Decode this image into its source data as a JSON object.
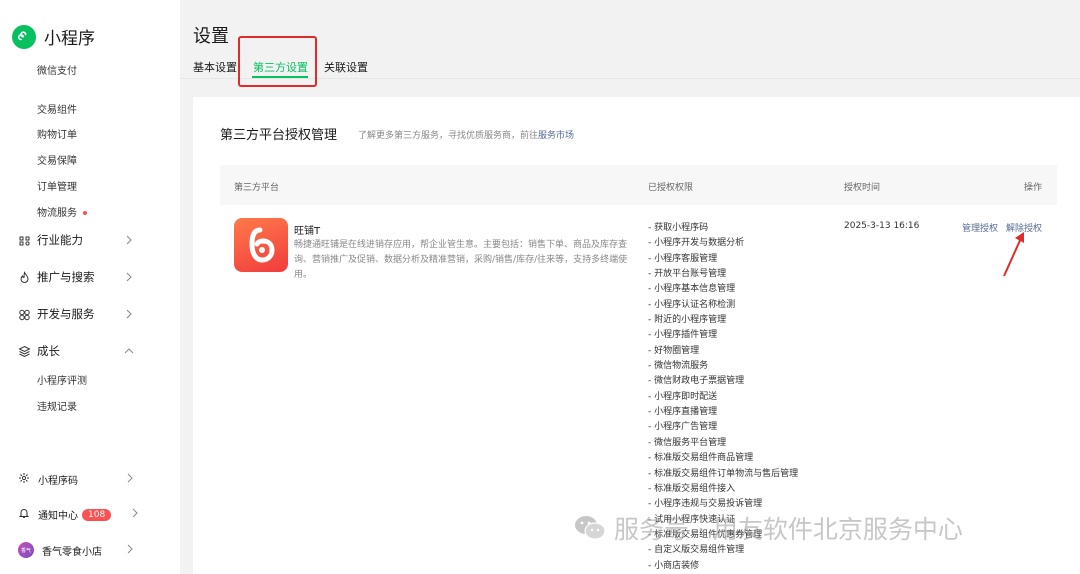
{
  "app": {
    "name": "小程序"
  },
  "sidebar": {
    "top_item": "微信支付",
    "sub_items": [
      {
        "label": "交易组件"
      },
      {
        "label": "购物订单"
      },
      {
        "label": "交易保障"
      },
      {
        "label": "订单管理"
      },
      {
        "label": "物流服务",
        "has_dot": true
      }
    ],
    "groups": [
      {
        "label": "行业能力",
        "icon": "industry-icon",
        "expanded": false
      },
      {
        "label": "推广与搜索",
        "icon": "promote-icon",
        "expanded": false
      },
      {
        "label": "开发与服务",
        "icon": "develop-icon",
        "expanded": false
      },
      {
        "label": "成长",
        "icon": "growth-icon",
        "expanded": true
      }
    ],
    "growth_items": [
      {
        "label": "小程序评测"
      },
      {
        "label": "违规记录"
      }
    ],
    "bottom": {
      "qrcode_label": "小程序码",
      "notify_label": "通知中心",
      "notify_count": "108",
      "account_label": "香气零食小店",
      "avatar_text": "香气"
    }
  },
  "page": {
    "title": "设置",
    "tabs": [
      {
        "label": "基本设置",
        "active": false
      },
      {
        "label": "第三方设置",
        "active": true
      },
      {
        "label": "关联设置",
        "active": false
      }
    ]
  },
  "section": {
    "title": "第三方平台授权管理",
    "note": "了解更多第三方服务，寻找优质服务商，前往",
    "note_link": "服务市场",
    "columns": [
      "第三方平台",
      "已授权权限",
      "授权时间",
      "操作"
    ]
  },
  "row": {
    "app_name": "旺铺T",
    "app_desc": "畅捷通旺铺是在线进销存应用，帮企业管生意。主要包括：销售下单、商品及库存查询、营销推广及促销、数据分析及精准营销，采购/销售/库存/往来等，支持多终端使用。",
    "permissions": [
      "- 获取小程序码",
      "- 小程序开发与数据分析",
      "- 小程序客服管理",
      "- 开放平台账号管理",
      "- 小程序基本信息管理",
      "- 小程序认证名称检测",
      "- 附近的小程序管理",
      "- 小程序插件管理",
      "- 好物圈管理",
      "- 微信物流服务",
      "- 微信财政电子票据管理",
      "- 小程序即时配送",
      "- 小程序直播管理",
      "- 小程序广告管理",
      "- 微信服务平台管理",
      "- 标准版交易组件商品管理",
      "- 标准版交易组件订单物流与售后管理",
      "- 标准版交易组件接入",
      "- 小程序违规与交易投诉管理",
      "- 试用小程序快速认证",
      "- 标准版交易组件优惠券管理",
      "- 自定义版交易组件管理",
      "- 小商店装修"
    ],
    "auth_time": "2025-3-13 16:16",
    "manage_label": "管理授权",
    "revoke_label": "解除授权"
  },
  "watermark": {
    "text": "服务号 · 用友软件北京服务中心"
  },
  "colors": {
    "accent": "#07c160",
    "link": "#576b95",
    "highlight": "#e02b2b",
    "badge": "#fa5151"
  }
}
